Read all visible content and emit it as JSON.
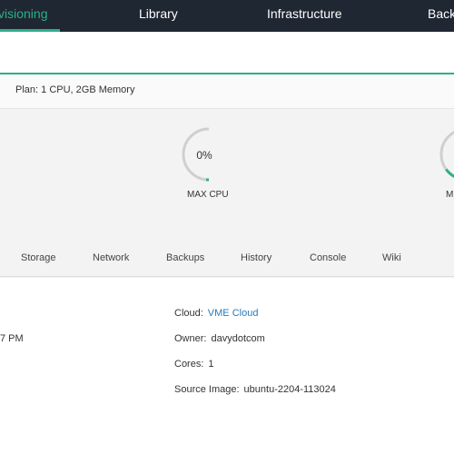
{
  "nav": {
    "items": [
      {
        "label": "visioning",
        "active": true
      },
      {
        "label": "Library",
        "active": false
      },
      {
        "label": "Infrastructure",
        "active": false
      },
      {
        "label": "Backu",
        "active": false
      }
    ]
  },
  "plan": {
    "label": "Plan:",
    "value": "1 CPU, 2GB Memory"
  },
  "gauges": [
    {
      "value_text": "0%",
      "label": "MAX CPU",
      "fraction": 0.0
    },
    {
      "value_text": "",
      "label": "M",
      "fraction": 0.3
    }
  ],
  "tabs": [
    "Storage",
    "Network",
    "Backups",
    "History",
    "Console",
    "Wiki"
  ],
  "details": {
    "partial_left": "7 PM",
    "cloud": {
      "label": "Cloud:",
      "value": "VME Cloud"
    },
    "owner": {
      "label": "Owner:",
      "value": "davydotcom"
    },
    "cores": {
      "label": "Cores:",
      "value": "1"
    },
    "source_image": {
      "label": "Source Image:",
      "value": "ubuntu-2204-113024"
    }
  },
  "colors": {
    "accent": "#2bb08a",
    "nav_bg": "#1f2733",
    "link": "#2a7ab8"
  }
}
